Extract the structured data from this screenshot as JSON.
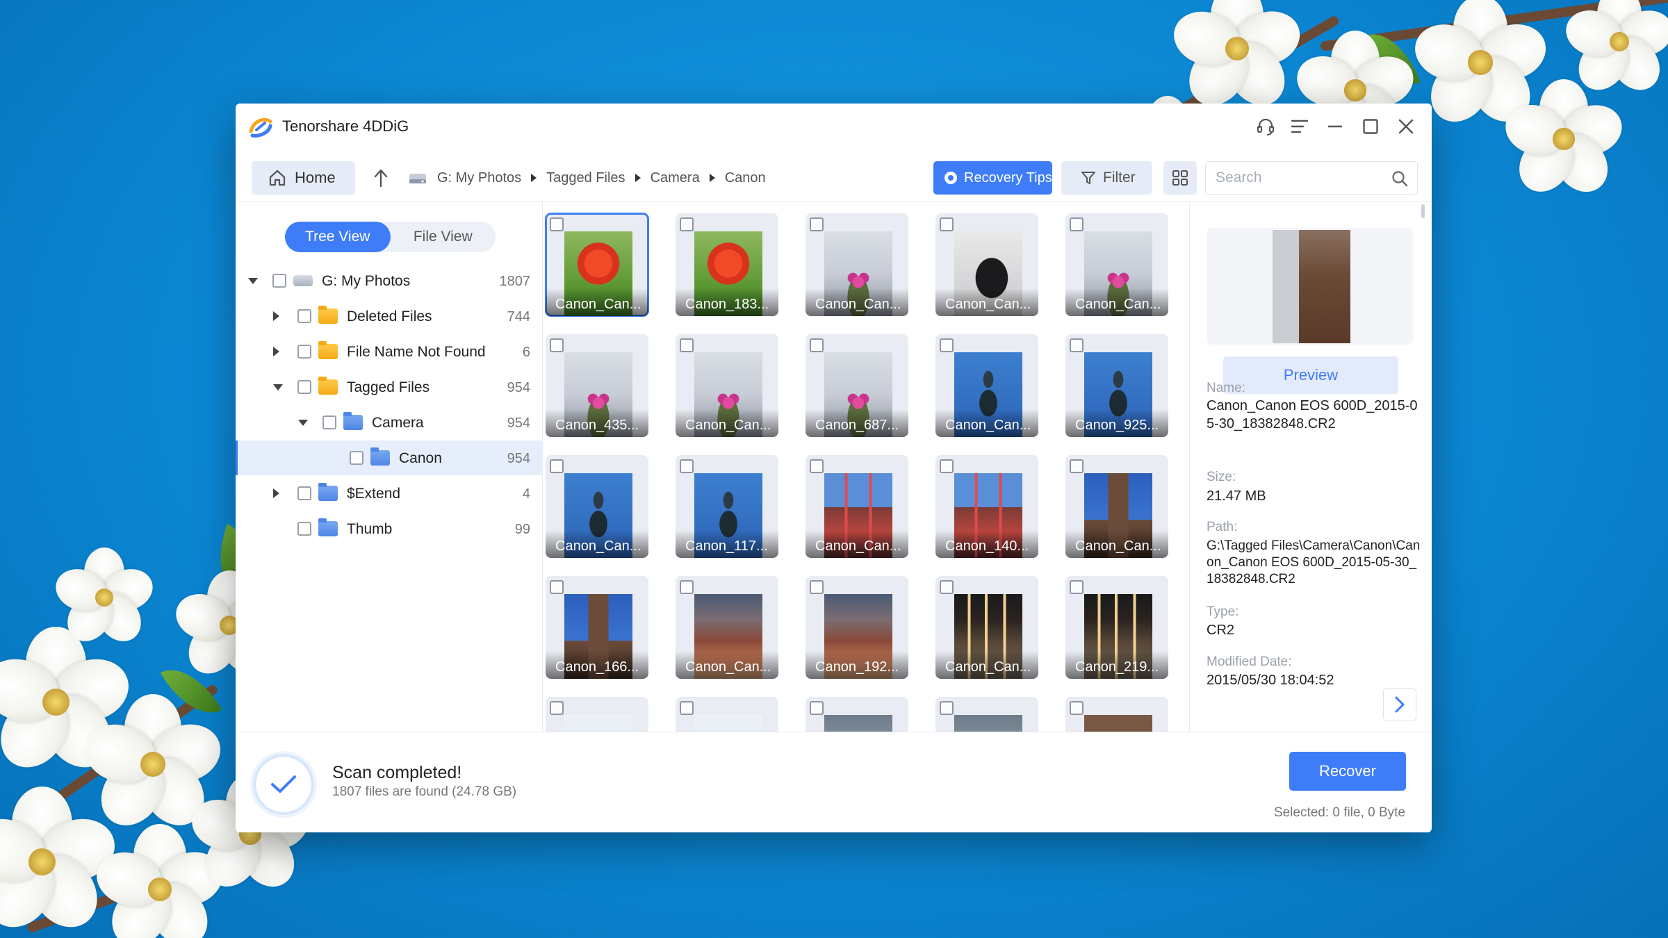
{
  "app": {
    "title": "Tenorshare 4DDiG"
  },
  "window_controls": [
    {
      "name": "support-icon"
    },
    {
      "name": "menu-icon"
    },
    {
      "name": "minimize-icon"
    },
    {
      "name": "maximize-icon"
    },
    {
      "name": "close-icon"
    }
  ],
  "nav": {
    "home_label": "Home",
    "breadcrumb": [
      "G: My Photos",
      "Tagged Files",
      "Camera",
      "Canon"
    ],
    "recovery_tips_label": "Recovery Tips",
    "filter_label": "Filter",
    "search_placeholder": "Search"
  },
  "view_toggle": {
    "tree_view": "Tree View",
    "file_view": "File View",
    "active": "Tree View"
  },
  "tree": [
    {
      "label": "G: My Photos",
      "count": "1807",
      "icon": "drive-icon",
      "expanded": true
    },
    {
      "label": "Deleted Files",
      "count": "744",
      "icon": "folder-deleted-icon",
      "expanded": false
    },
    {
      "label": "File Name Not Found",
      "count": "6",
      "icon": "folder-unknown-icon",
      "expanded": false
    },
    {
      "label": "Tagged Files",
      "count": "954",
      "icon": "folder-tagged-icon",
      "expanded": true
    },
    {
      "label": "Camera",
      "count": "954",
      "icon": "folder-icon",
      "expanded": true
    },
    {
      "label": "Canon",
      "count": "954",
      "icon": "folder-icon",
      "selected": true
    },
    {
      "label": "$Extend",
      "count": "4",
      "icon": "folder-icon",
      "expanded": false
    },
    {
      "label": "Thumb",
      "count": "99",
      "icon": "folder-icon"
    }
  ],
  "files": [
    {
      "caption": "Canon_Can...",
      "thumb": "poppy"
    },
    {
      "caption": "Canon_183...",
      "thumb": "poppy"
    },
    {
      "caption": "Canon_Can...",
      "thumb": "cactus"
    },
    {
      "caption": "Canon_Can...",
      "thumb": "cat"
    },
    {
      "caption": "Canon_Can...",
      "thumb": "cactus"
    },
    {
      "caption": "Canon_435...",
      "thumb": "cactus"
    },
    {
      "caption": "Canon_Can...",
      "thumb": "cactus"
    },
    {
      "caption": "Canon_687...",
      "thumb": "cactus"
    },
    {
      "caption": "Canon_Can...",
      "thumb": "statue"
    },
    {
      "caption": "Canon_925...",
      "thumb": "statue"
    },
    {
      "caption": "Canon_Can...",
      "thumb": "statue"
    },
    {
      "caption": "Canon_117...",
      "thumb": "statue"
    },
    {
      "caption": "Canon_Can...",
      "thumb": "bldg-red"
    },
    {
      "caption": "Canon_140...",
      "thumb": "bldg-red"
    },
    {
      "caption": "Canon_Can...",
      "thumb": "tower"
    },
    {
      "caption": "Canon_166...",
      "thumb": "tower"
    },
    {
      "caption": "Canon_Can...",
      "thumb": "street"
    },
    {
      "caption": "Canon_192...",
      "thumb": "street"
    },
    {
      "caption": "Canon_Can...",
      "thumb": "night"
    },
    {
      "caption": "Canon_219...",
      "thumb": "night"
    },
    {
      "caption": "",
      "thumb": "land"
    },
    {
      "caption": "",
      "thumb": "land"
    },
    {
      "caption": "",
      "thumb": "haze"
    },
    {
      "caption": "",
      "thumb": "haze"
    },
    {
      "caption": "",
      "thumb": "wall"
    }
  ],
  "detail": {
    "preview_label": "Preview",
    "name_label": "Name:",
    "name_value": "Canon_Canon EOS 600D_2015-05-30_18382848.CR2",
    "size_label": "Size:",
    "size_value": "21.47 MB",
    "path_label": "Path:",
    "path_value": "G:\\Tagged Files\\Camera\\Canon\\Canon_Canon EOS 600D_2015-05-30_18382848.CR2",
    "type_label": "Type:",
    "type_value": "CR2",
    "modified_label": "Modified Date:",
    "modified_value": "2015/05/30 18:04:52"
  },
  "status": {
    "title": "Scan completed!",
    "subtitle": "1807 files are found (24.78 GB)",
    "recover_label": "Recover",
    "selected_info": "Selected: 0 file, 0 Byte"
  },
  "colors": {
    "accent": "#3e7df7",
    "background": "#0b86d2"
  }
}
